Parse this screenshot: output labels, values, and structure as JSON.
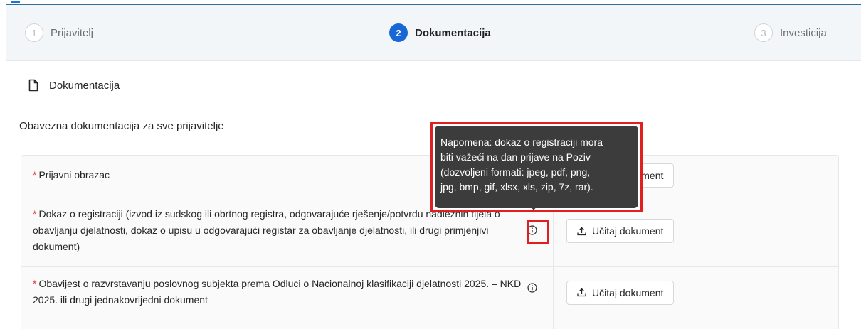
{
  "stepper": {
    "steps": [
      {
        "number": "1",
        "label": "Prijavitelj",
        "state": "inactive"
      },
      {
        "number": "2",
        "label": "Dokumentacija",
        "state": "active"
      },
      {
        "number": "3",
        "label": "Investicija",
        "state": "inactive"
      }
    ]
  },
  "section": {
    "icon": "document-icon",
    "title": "Dokumentacija",
    "subtitle": "Obavezna dokumentacija za sve prijavitelje"
  },
  "documents": [
    {
      "required_mark": "*",
      "label": "Prijavni obrazac",
      "has_info": false,
      "upload_label": "Učitaj dokument"
    },
    {
      "required_mark": "*",
      "label": "Dokaz o registraciji (izvod iz sudskog ili obrtnog registra, odgovarajuće rješenje/potvrdu nadležnih tijela o obavljanju djelatnosti, dokaz o upisu u odgovarajući registar za obavljanje djelatnosti, ili drugi primjenjivi dokument)",
      "has_info": true,
      "upload_label": "Učitaj dokument"
    },
    {
      "required_mark": "*",
      "label": "Obavijest o razvrstavanju poslovnog subjekta prema Odluci o Nacionalnoj klasifikaciji djelatnosti 2025. – NKD 2025. ili drugi jednakovrijedni dokument",
      "has_info": true,
      "upload_label": "Učitaj dokument"
    }
  ],
  "tooltip": {
    "lines": [
      "Napomena: dokaz o registraciji mora",
      "biti važeći na dan prijave na Poziv",
      "(dozvoljeni formati: jpeg, pdf, png,",
      "jpg, bmp, gif, xlsx, xls, zip, 7z, rar)."
    ]
  },
  "colors": {
    "accent": "#1767d6",
    "required": "#e5313a",
    "highlight": "#e02020",
    "tooltip_bg": "#3c3c3c"
  }
}
